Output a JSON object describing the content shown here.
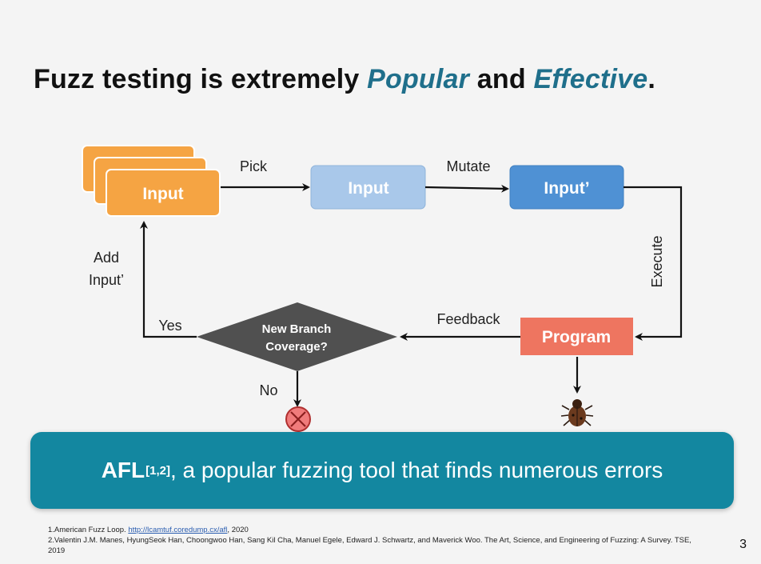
{
  "title": {
    "prefix": "Fuzz testing is extremely ",
    "word1": "Popular",
    "middle": " and ",
    "word2": "Effective",
    "suffix": "."
  },
  "diagram": {
    "seed_box": "Input",
    "picked_box": "Input",
    "mutated_box": "Input’",
    "program_box": "Program",
    "decision_line1": "New Branch",
    "decision_line2": "Coverage?",
    "edge_pick": "Pick",
    "edge_mutate": "Mutate",
    "edge_execute": "Execute",
    "edge_feedback": "Feedback",
    "edge_yes": "Yes",
    "edge_no": "No",
    "edge_add_line1": "Add",
    "edge_add_line2": "Input’"
  },
  "banner": {
    "afl": "AFL",
    "refs": "[1,2]",
    "text": " , a popular fuzzing tool that finds numerous errors"
  },
  "references": {
    "ref1_text": "1.American Fuzz Loop. ",
    "ref1_link": "http://lcamtuf.coredump.cx/afl",
    "ref1_year": ", 2020",
    "ref2": "2.Valentin J.M. Manes, HyungSeok Han, Choongwoo Han, Sang Kil Cha, Manuel Egele, Edward J. Schwartz, and Maverick Woo. The Art, Science, and Engineering of Fuzzing: A Survey. TSE, 2019"
  },
  "page_number": "3",
  "colors": {
    "seed_orange": "#f5a443",
    "picked_blue": "#a9c8ea",
    "mutated_blue": "#4f91d4",
    "program_red": "#ee7560",
    "diamond_gray": "#505050",
    "banner_teal": "#1387a0",
    "title_accent": "#1f6f8b"
  }
}
